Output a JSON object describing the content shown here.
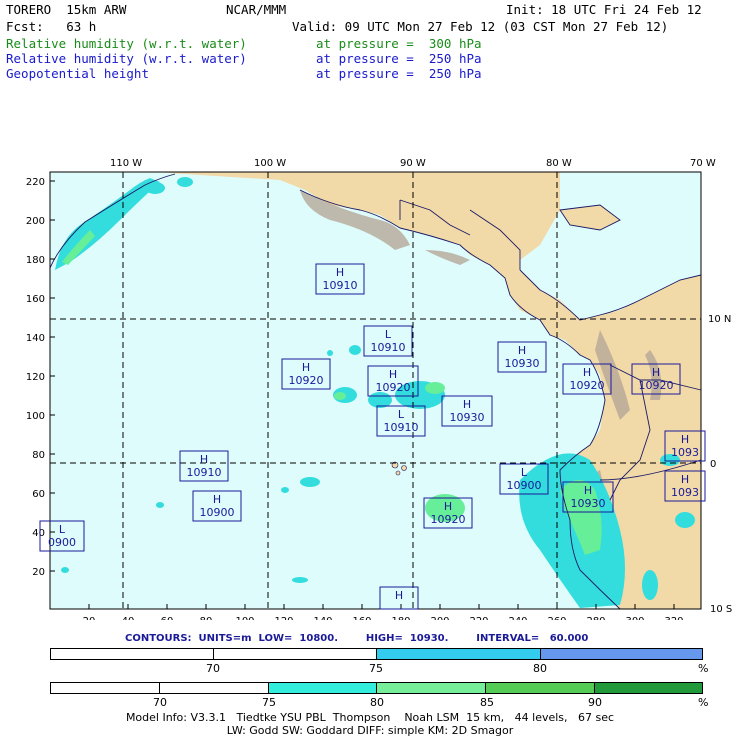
{
  "header": {
    "model": "TORERO  15km ARW",
    "org": "NCAR/MMM",
    "init": "Init: 18 UTC Fri 24 Feb 12",
    "fcst": "Fcst:   63 h",
    "valid": "Valid: 09 UTC Mon 27 Feb 12 (03 CST Mon 27 Feb 12)",
    "fields": [
      {
        "name": "Relative humidity (w.r.t. water)",
        "level": "at pressure =  300 hPa",
        "color": "#1a8c1a"
      },
      {
        "name": "Relative humidity (w.r.t. water)",
        "level": "at pressure =  250 hPa",
        "color": "#1a1acc"
      },
      {
        "name": "Geopotential height",
        "level": "at pressure =  250 hPa",
        "color": "#1a1acc"
      }
    ]
  },
  "map": {
    "colors": {
      "ocean": "#dffcfc",
      "land": "#f2d9a8",
      "mountain": "#b5a898",
      "rh_teal": "#33dddd",
      "rh_green": "#66ee99",
      "grid": "#000000",
      "coast": "#1a1a66"
    },
    "lon_labels": [
      "110 W",
      "100 W",
      "90 W",
      "80 W",
      "70 W"
    ],
    "lat_labels": [
      "10 N",
      "0",
      "10 S"
    ],
    "y_ticks": [
      "220",
      "200",
      "180",
      "160",
      "140",
      "120",
      "100",
      "80",
      "60",
      "40",
      "20"
    ],
    "x_ticks": [
      "20",
      "40",
      "60",
      "80",
      "100",
      "120",
      "140",
      "160",
      "180",
      "200",
      "220",
      "240",
      "260",
      "280",
      "300",
      "320"
    ],
    "centers": [
      {
        "type": "H",
        "value": "10910"
      },
      {
        "type": "L",
        "value": "10910"
      },
      {
        "type": "H",
        "value": "10920"
      },
      {
        "type": "H",
        "value": "10920"
      },
      {
        "type": "L",
        "value": "10910"
      },
      {
        "type": "H",
        "value": "10930"
      },
      {
        "type": "H",
        "value": "10930"
      },
      {
        "type": "H",
        "value": "10920"
      },
      {
        "type": "H",
        "value": "10920"
      },
      {
        "type": "H",
        "value": "1093"
      },
      {
        "type": "H",
        "value": "10910"
      },
      {
        "type": "H",
        "value": "10900"
      },
      {
        "type": "L",
        "value": "10900"
      },
      {
        "type": "H",
        "value": "10930"
      },
      {
        "type": "H",
        "value": "1093"
      },
      {
        "type": "L",
        "value": "0900"
      },
      {
        "type": "H",
        "value": "10920"
      },
      {
        "type": "H",
        "value": ""
      }
    ]
  },
  "contours": {
    "text": "CONTOURS:  UNITS=m  LOW=  10800.        HIGH=  10930.        INTERVAL=   60.000"
  },
  "legend_blue": {
    "labels": [
      "70",
      "75",
      "80",
      "%"
    ],
    "colors": [
      "#ffffff",
      "#ffffff",
      "#33ccee",
      "#6699ee"
    ]
  },
  "legend_green": {
    "labels": [
      "70",
      "75",
      "80",
      "85",
      "90",
      "%"
    ],
    "colors": [
      "#ffffff",
      "#ffffff",
      "#33eedd",
      "#77ee99",
      "#55cc55",
      "#22993a"
    ]
  },
  "footer": {
    "line1": "Model Info: V3.3.1   Tiedtke YSU PBL  Thompson    Noah LSM  15 km,   44 levels,   67 sec",
    "line2": "LW: Godd SW: Goddard DIFF: simple KM: 2D Smagor"
  }
}
